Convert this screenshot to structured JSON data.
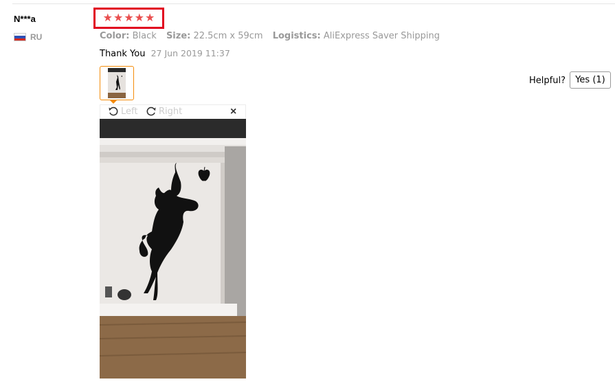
{
  "review": {
    "user_name": "N***a",
    "country_code": "RU",
    "rating_stars": 5,
    "star_glyph": "★",
    "attributes": [
      {
        "key": "Color:",
        "value": "Black"
      },
      {
        "key": "Size:",
        "value": "22.5cm x 59cm"
      },
      {
        "key": "Logistics:",
        "value": "AliExpress Saver Shipping"
      }
    ],
    "feedback_text": "Thank You",
    "date": "27 Jun 2019 11:37",
    "helpful_label": "Helpful?",
    "helpful_button": "Yes (1)"
  },
  "viewer": {
    "rotate_left": "Left",
    "rotate_right": "Right",
    "close": "×"
  },
  "colors": {
    "star": "#e94e4e",
    "highlight_box": "#e1001e",
    "thumb_border": "#f48c0a"
  }
}
